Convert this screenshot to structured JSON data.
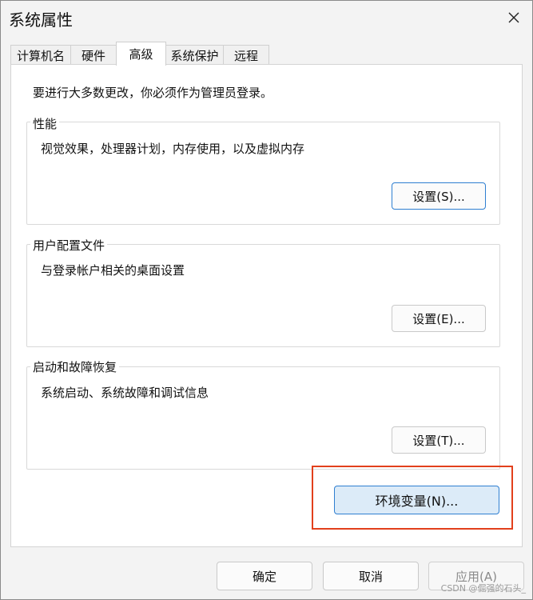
{
  "window": {
    "title": "系统属性"
  },
  "tabs": [
    {
      "label": "计算机名",
      "active": false
    },
    {
      "label": "硬件",
      "active": false
    },
    {
      "label": "高级",
      "active": true
    },
    {
      "label": "系统保护",
      "active": false
    },
    {
      "label": "远程",
      "active": false
    }
  ],
  "panel": {
    "admin_note": "要进行大多数更改，你必须作为管理员登录。",
    "groups": [
      {
        "title": "性能",
        "description": "视觉效果，处理器计划，内存使用，以及虚拟内存",
        "button": "设置(S)..."
      },
      {
        "title": "用户配置文件",
        "description": "与登录帐户相关的桌面设置",
        "button": "设置(E)..."
      },
      {
        "title": "启动和故障恢复",
        "description": "系统启动、系统故障和调试信息",
        "button": "设置(T)..."
      }
    ],
    "env_button": "环境变量(N)..."
  },
  "footer": {
    "ok": "确定",
    "cancel": "取消",
    "apply": "应用(A)"
  },
  "watermark": "CSDN @倔强的石头_",
  "colors": {
    "highlight": "#e2401c",
    "focus_border": "#2f7fd1",
    "env_button_bg": "#dcebf8"
  }
}
